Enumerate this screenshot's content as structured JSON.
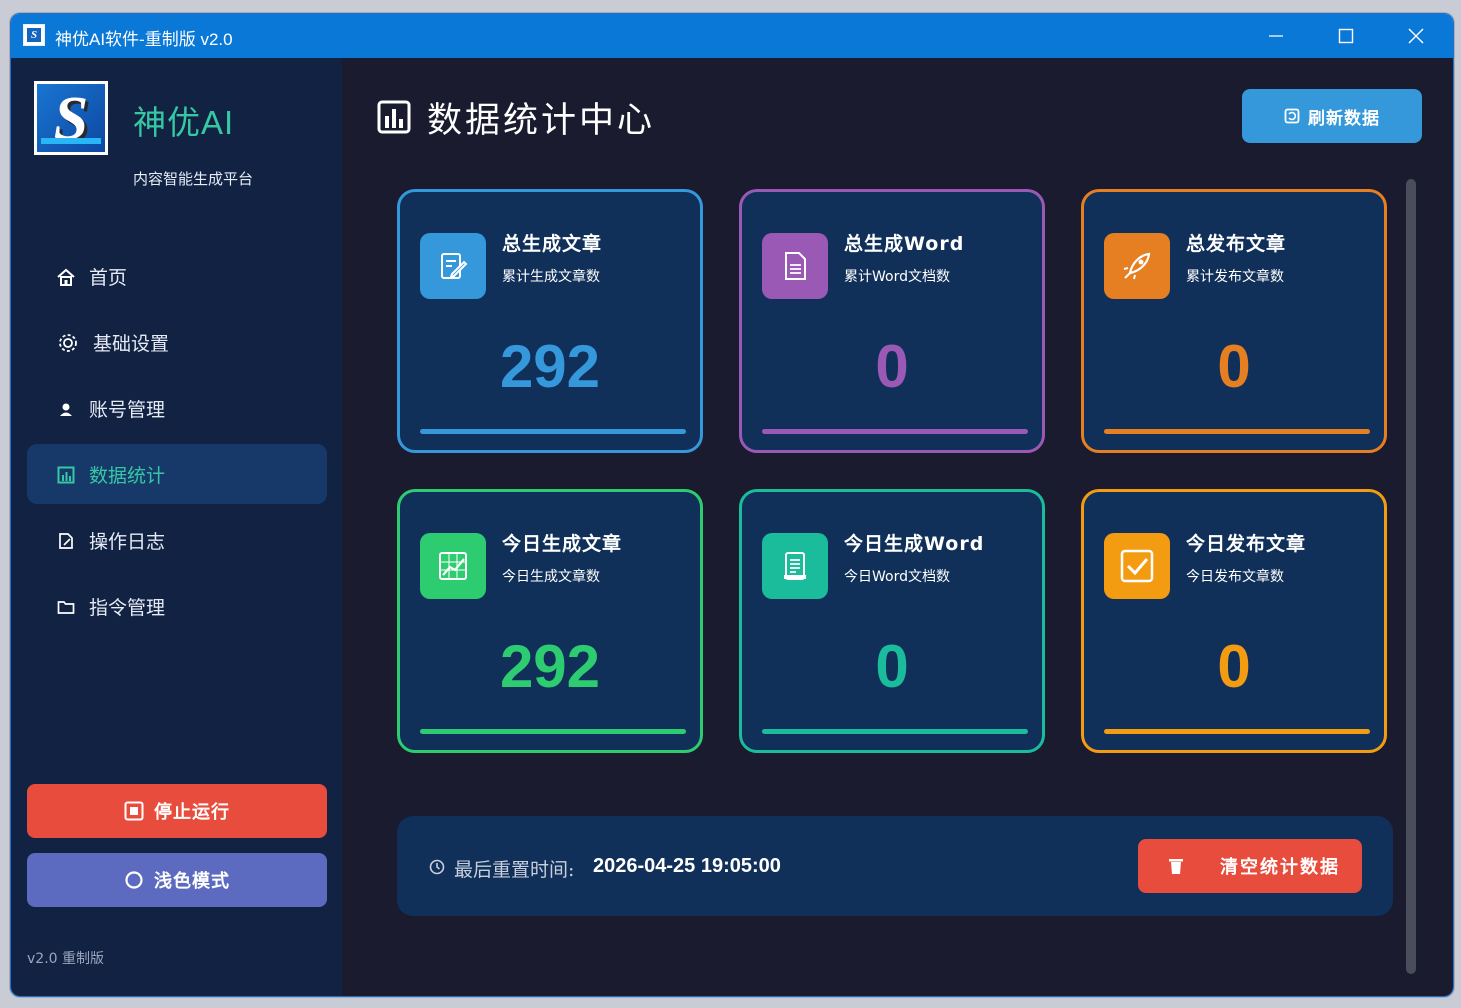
{
  "window": {
    "title": "神优AI软件-重制版 v2.0",
    "controls": [
      "minimize",
      "maximize",
      "close"
    ]
  },
  "sidebar": {
    "brand": "神优AI",
    "subtitle": "内容智能生成平台",
    "items": [
      {
        "label": "首页",
        "icon": "home-icon"
      },
      {
        "label": "基础设置",
        "icon": "gear-icon"
      },
      {
        "label": "账号管理",
        "icon": "user-icon"
      },
      {
        "label": "数据统计",
        "icon": "chart-icon",
        "active": true
      },
      {
        "label": "操作日志",
        "icon": "log-icon"
      },
      {
        "label": "指令管理",
        "icon": "folder-icon"
      }
    ],
    "stop_button": "停止运行",
    "light_mode_button": "浅色模式",
    "version": "v2.0 重制版"
  },
  "main": {
    "title": "数据统计中心",
    "refresh_button": "刷新数据",
    "cards": [
      {
        "title": "总生成文章",
        "subtitle": "累计生成文章数",
        "value": "292",
        "color": "#3498db",
        "icon": "edit-icon"
      },
      {
        "title": "总生成Word",
        "subtitle": "累计Word文档数",
        "value": "0",
        "color": "#9b59b6",
        "icon": "document-icon"
      },
      {
        "title": "总发布文章",
        "subtitle": "累计发布文章数",
        "value": "0",
        "color": "#e67e22",
        "icon": "rocket-icon"
      },
      {
        "title": "今日生成文章",
        "subtitle": "今日生成文章数",
        "value": "292",
        "color": "#2ecc71",
        "icon": "chart-line-icon"
      },
      {
        "title": "今日生成Word",
        "subtitle": "今日Word文档数",
        "value": "0",
        "color": "#1abc9c",
        "icon": "word-doc-icon"
      },
      {
        "title": "今日发布文章",
        "subtitle": "今日发布文章数",
        "value": "0",
        "color": "#f39c12",
        "icon": "checkbox-icon"
      }
    ],
    "footer": {
      "reset_label": "最后重置时间:",
      "reset_value": "2026-04-25 19:05:00",
      "clear_button": "清空统计数据"
    }
  }
}
